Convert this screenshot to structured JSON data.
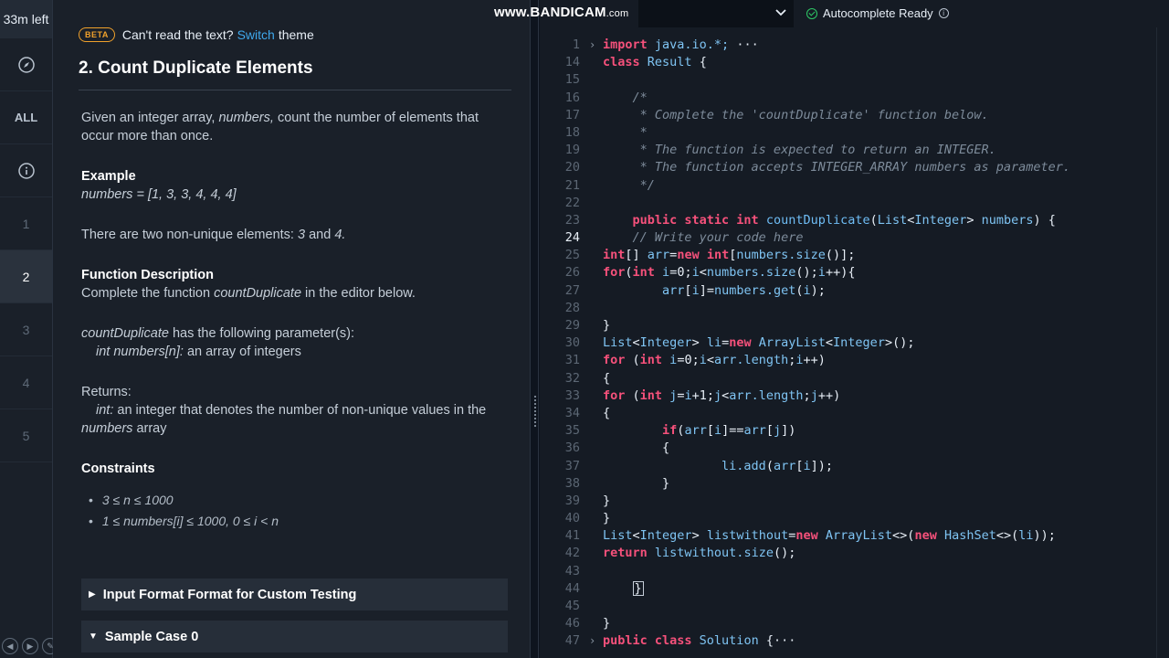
{
  "timer": "33m left",
  "rail": {
    "all_label": "ALL",
    "questions": [
      "1",
      "2",
      "3",
      "4",
      "5"
    ],
    "active_question": "2"
  },
  "problem": {
    "beta_badge": "BETA",
    "theme_prompt": "Can't read the text?",
    "theme_link": "Switch",
    "theme_suffix": "theme",
    "title": "2. Count Duplicate Elements",
    "intro_1": "Given an integer array,",
    "intro_em": "numbers,",
    "intro_2": "count the number of elements that occur more than once.",
    "example_heading": "Example",
    "example_value": "numbers = [1, 3, 3, 4, 4, 4]",
    "example_text_1": "There are two non-unique elements:",
    "example_em_1": "3",
    "example_text_2": "and",
    "example_em_2": "4.",
    "func_heading": "Function Description",
    "func_text_1": "Complete the function",
    "func_em": "countDuplicate",
    "func_text_2": "in the editor below.",
    "params_em": "countDuplicate",
    "params_text": "has the following parameter(s):",
    "param_em": "int numbers[n]:",
    "param_text": "an array of integers",
    "returns_heading": "Returns:",
    "returns_em": "int:",
    "returns_text_1": "an integer that denotes the number of non-unique values in the",
    "returns_em_2": "numbers",
    "returns_text_2": "array",
    "constraints_heading": "Constraints",
    "constraints": [
      "3 ≤ n ≤ 1000",
      "1 ≤ numbers[i] ≤ 1000, 0 ≤ i < n"
    ],
    "accordion_1": "Input Format Format for Custom Testing",
    "accordion_2": "Sample Case 0"
  },
  "editor": {
    "watermark": "www.BANDICAM",
    "watermark_suffix": ".com",
    "autocomplete": "Autocomplete Ready",
    "current_line": "24",
    "lines": [
      {
        "n": "1",
        "fold": "›",
        "tokens": [
          [
            "kw",
            "import "
          ],
          [
            "txt",
            "java.io.*;"
          ],
          [
            "pl",
            " ···"
          ]
        ]
      },
      {
        "n": "14",
        "fold": "",
        "tokens": [
          [
            "kw",
            "class "
          ],
          [
            "cls",
            "Result "
          ],
          [
            "pl",
            "{"
          ]
        ]
      },
      {
        "n": "15",
        "fold": "",
        "tokens": []
      },
      {
        "n": "16",
        "fold": "",
        "tokens": [
          [
            "cm",
            "    /*"
          ]
        ]
      },
      {
        "n": "17",
        "fold": "",
        "tokens": [
          [
            "cm",
            "     * Complete the 'countDuplicate' function below."
          ]
        ]
      },
      {
        "n": "18",
        "fold": "",
        "tokens": [
          [
            "cm",
            "     *"
          ]
        ]
      },
      {
        "n": "19",
        "fold": "",
        "tokens": [
          [
            "cm",
            "     * The function is expected to return an INTEGER."
          ]
        ]
      },
      {
        "n": "20",
        "fold": "",
        "tokens": [
          [
            "cm",
            "     * The function accepts INTEGER_ARRAY numbers as parameter."
          ]
        ]
      },
      {
        "n": "21",
        "fold": "",
        "tokens": [
          [
            "cm",
            "     */"
          ]
        ]
      },
      {
        "n": "22",
        "fold": "",
        "tokens": []
      },
      {
        "n": "23",
        "fold": "",
        "tokens": [
          [
            "pl",
            "    "
          ],
          [
            "kw",
            "public static int "
          ],
          [
            "fn",
            "countDuplicate"
          ],
          [
            "pl",
            "("
          ],
          [
            "cls",
            "List"
          ],
          [
            "pl",
            "<"
          ],
          [
            "cls",
            "Integer"
          ],
          [
            "pl",
            "> "
          ],
          [
            "txt",
            "numbers"
          ],
          [
            "pl",
            ") {"
          ]
        ]
      },
      {
        "n": "24",
        "fold": "",
        "tokens": [
          [
            "cm",
            "    // Write your code here"
          ]
        ]
      },
      {
        "n": "25",
        "fold": "",
        "tokens": [
          [
            "kw",
            "int"
          ],
          [
            "pl",
            "[] "
          ],
          [
            "txt",
            "arr"
          ],
          [
            "pl",
            "="
          ],
          [
            "kw",
            "new int"
          ],
          [
            "pl",
            "["
          ],
          [
            "txt",
            "numbers.size"
          ],
          [
            "pl",
            "()];"
          ]
        ]
      },
      {
        "n": "26",
        "fold": "",
        "tokens": [
          [
            "kw",
            "for"
          ],
          [
            "pl",
            "("
          ],
          [
            "kw",
            "int "
          ],
          [
            "txt",
            "i"
          ],
          [
            "pl",
            "=0;"
          ],
          [
            "txt",
            "i"
          ],
          [
            "pl",
            "<"
          ],
          [
            "txt",
            "numbers.size"
          ],
          [
            "pl",
            "();"
          ],
          [
            "txt",
            "i"
          ],
          [
            "pl",
            "++){"
          ]
        ]
      },
      {
        "n": "27",
        "fold": "",
        "tokens": [
          [
            "pl",
            "        "
          ],
          [
            "txt",
            "arr"
          ],
          [
            "pl",
            "["
          ],
          [
            "txt",
            "i"
          ],
          [
            "pl",
            "]="
          ],
          [
            "txt",
            "numbers.get"
          ],
          [
            "pl",
            "("
          ],
          [
            "txt",
            "i"
          ],
          [
            "pl",
            ");"
          ]
        ]
      },
      {
        "n": "28",
        "fold": "",
        "tokens": []
      },
      {
        "n": "29",
        "fold": "",
        "tokens": [
          [
            "pl",
            "}"
          ]
        ]
      },
      {
        "n": "30",
        "fold": "",
        "tokens": [
          [
            "cls",
            "List"
          ],
          [
            "pl",
            "<"
          ],
          [
            "cls",
            "Integer"
          ],
          [
            "pl",
            "> "
          ],
          [
            "txt",
            "li"
          ],
          [
            "pl",
            "="
          ],
          [
            "kw",
            "new "
          ],
          [
            "cls",
            "ArrayList"
          ],
          [
            "pl",
            "<"
          ],
          [
            "cls",
            "Integer"
          ],
          [
            "pl",
            ">();"
          ]
        ]
      },
      {
        "n": "31",
        "fold": "",
        "tokens": [
          [
            "kw",
            "for "
          ],
          [
            "pl",
            "("
          ],
          [
            "kw",
            "int "
          ],
          [
            "txt",
            "i"
          ],
          [
            "pl",
            "=0;"
          ],
          [
            "txt",
            "i"
          ],
          [
            "pl",
            "<"
          ],
          [
            "txt",
            "arr.length"
          ],
          [
            "pl",
            ";"
          ],
          [
            "txt",
            "i"
          ],
          [
            "pl",
            "++)"
          ]
        ]
      },
      {
        "n": "32",
        "fold": "",
        "tokens": [
          [
            "pl",
            "{"
          ]
        ]
      },
      {
        "n": "33",
        "fold": "",
        "tokens": [
          [
            "kw",
            "for "
          ],
          [
            "pl",
            "("
          ],
          [
            "kw",
            "int "
          ],
          [
            "txt",
            "j"
          ],
          [
            "pl",
            "="
          ],
          [
            "txt",
            "i"
          ],
          [
            "pl",
            "+1;"
          ],
          [
            "txt",
            "j"
          ],
          [
            "pl",
            "<"
          ],
          [
            "txt",
            "arr.length"
          ],
          [
            "pl",
            ";"
          ],
          [
            "txt",
            "j"
          ],
          [
            "pl",
            "++)"
          ]
        ]
      },
      {
        "n": "34",
        "fold": "",
        "tokens": [
          [
            "pl",
            "{"
          ]
        ]
      },
      {
        "n": "35",
        "fold": "",
        "tokens": [
          [
            "pl",
            "        "
          ],
          [
            "kw",
            "if"
          ],
          [
            "pl",
            "("
          ],
          [
            "txt",
            "arr"
          ],
          [
            "pl",
            "["
          ],
          [
            "txt",
            "i"
          ],
          [
            "pl",
            "]=="
          ],
          [
            "txt",
            "arr"
          ],
          [
            "pl",
            "["
          ],
          [
            "txt",
            "j"
          ],
          [
            "pl",
            "])"
          ]
        ]
      },
      {
        "n": "36",
        "fold": "",
        "tokens": [
          [
            "pl",
            "        {"
          ]
        ]
      },
      {
        "n": "37",
        "fold": "",
        "tokens": [
          [
            "pl",
            "                "
          ],
          [
            "txt",
            "li.add"
          ],
          [
            "pl",
            "("
          ],
          [
            "txt",
            "arr"
          ],
          [
            "pl",
            "["
          ],
          [
            "txt",
            "i"
          ],
          [
            "pl",
            "]);"
          ]
        ]
      },
      {
        "n": "38",
        "fold": "",
        "tokens": [
          [
            "pl",
            "        }"
          ]
        ]
      },
      {
        "n": "39",
        "fold": "",
        "tokens": [
          [
            "pl",
            "}"
          ]
        ]
      },
      {
        "n": "40",
        "fold": "",
        "tokens": [
          [
            "pl",
            "}"
          ]
        ]
      },
      {
        "n": "41",
        "fold": "",
        "tokens": [
          [
            "cls",
            "List"
          ],
          [
            "pl",
            "<"
          ],
          [
            "cls",
            "Integer"
          ],
          [
            "pl",
            "> "
          ],
          [
            "txt",
            "listwithout"
          ],
          [
            "pl",
            "="
          ],
          [
            "kw",
            "new "
          ],
          [
            "cls",
            "ArrayList"
          ],
          [
            "pl",
            "<>("
          ],
          [
            "kw",
            "new "
          ],
          [
            "cls",
            "HashSet"
          ],
          [
            "pl",
            "<>("
          ],
          [
            "txt",
            "li"
          ],
          [
            "pl",
            "));"
          ]
        ]
      },
      {
        "n": "42",
        "fold": "",
        "tokens": [
          [
            "kw",
            "return "
          ],
          [
            "txt",
            "listwithout.size"
          ],
          [
            "pl",
            "();"
          ]
        ]
      },
      {
        "n": "43",
        "fold": "",
        "tokens": []
      },
      {
        "n": "44",
        "fold": "",
        "tokens": [
          [
            "pl",
            "    "
          ],
          [
            "box",
            "}"
          ]
        ]
      },
      {
        "n": "45",
        "fold": "",
        "tokens": []
      },
      {
        "n": "46",
        "fold": "",
        "tokens": [
          [
            "pl",
            "}"
          ]
        ]
      },
      {
        "n": "47",
        "fold": "›",
        "tokens": [
          [
            "kw",
            "public class "
          ],
          [
            "cls",
            "Solution "
          ],
          [
            "pl",
            "{···"
          ]
        ]
      }
    ]
  }
}
